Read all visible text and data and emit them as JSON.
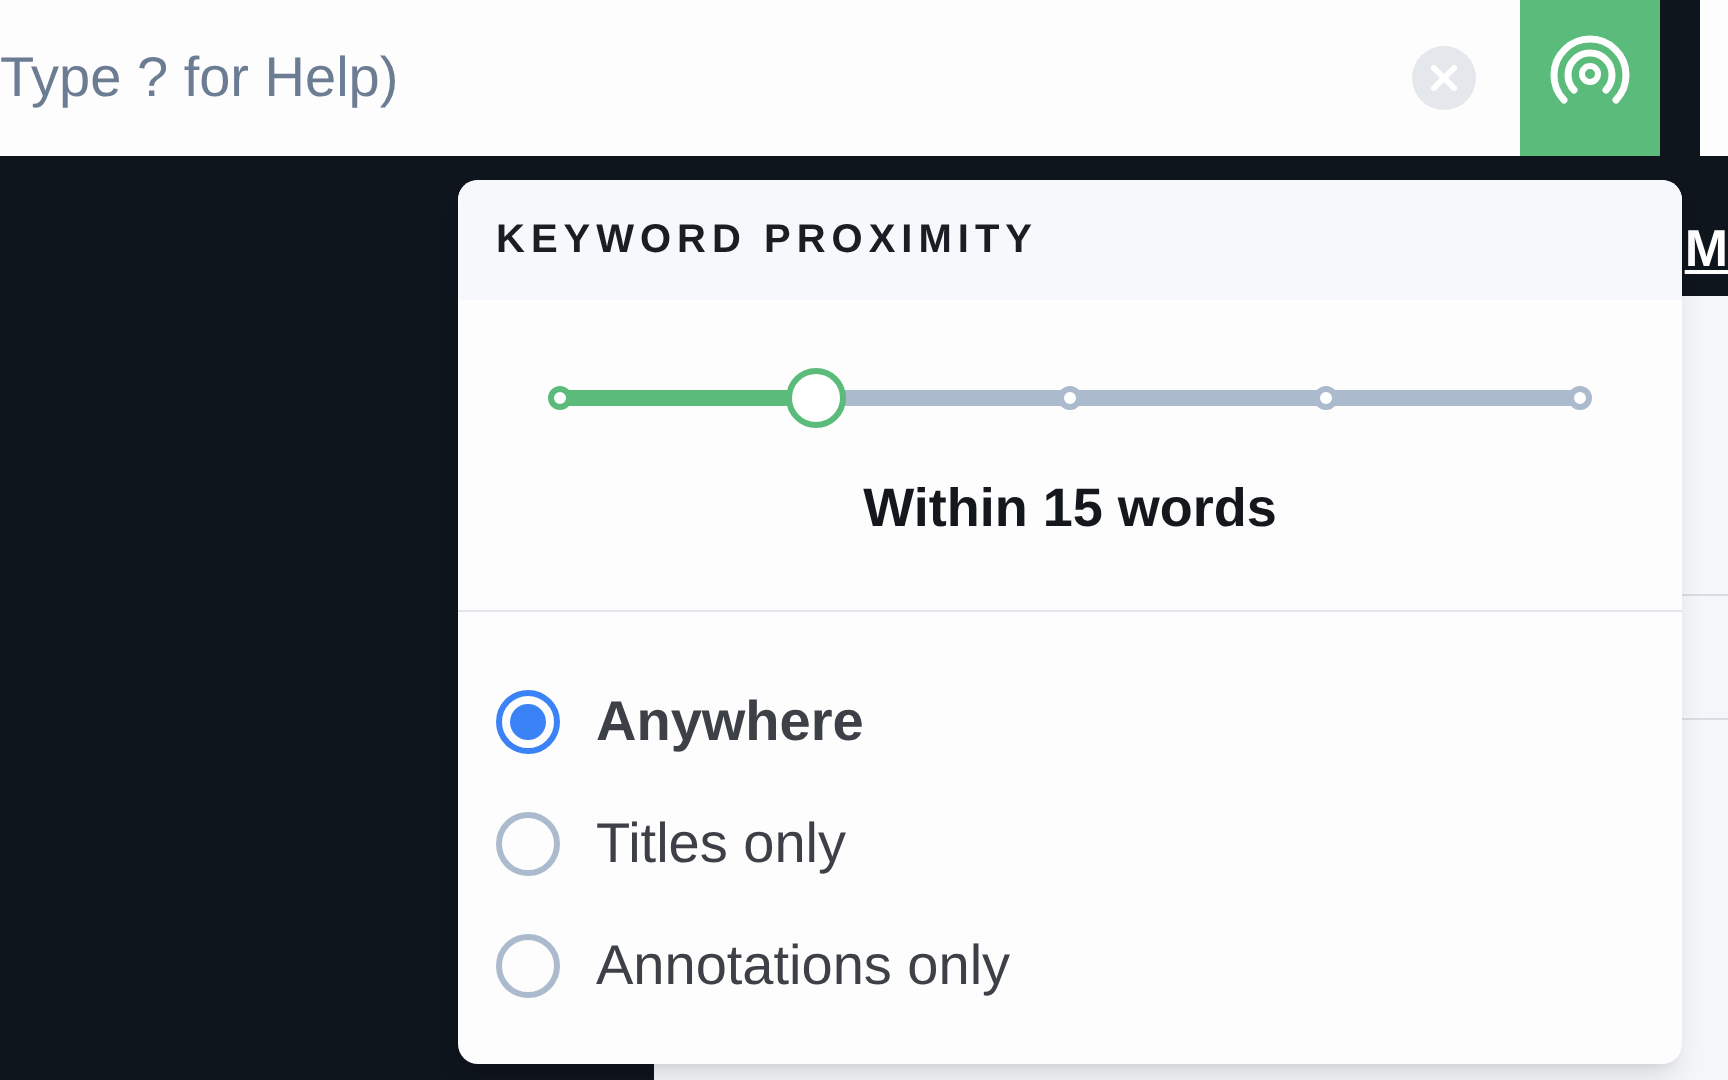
{
  "search": {
    "placeholder": "Type ? for Help)"
  },
  "background": {
    "header_letter": "M"
  },
  "proximity_popup": {
    "title": "KEYWORD PROXIMITY",
    "slider": {
      "level": 0.25
    },
    "reading": "Within 15 words",
    "options": [
      {
        "label": "Anywhere",
        "selected": true
      },
      {
        "label": "Titles only",
        "selected": false
      },
      {
        "label": "Annotations only",
        "selected": false
      }
    ]
  }
}
